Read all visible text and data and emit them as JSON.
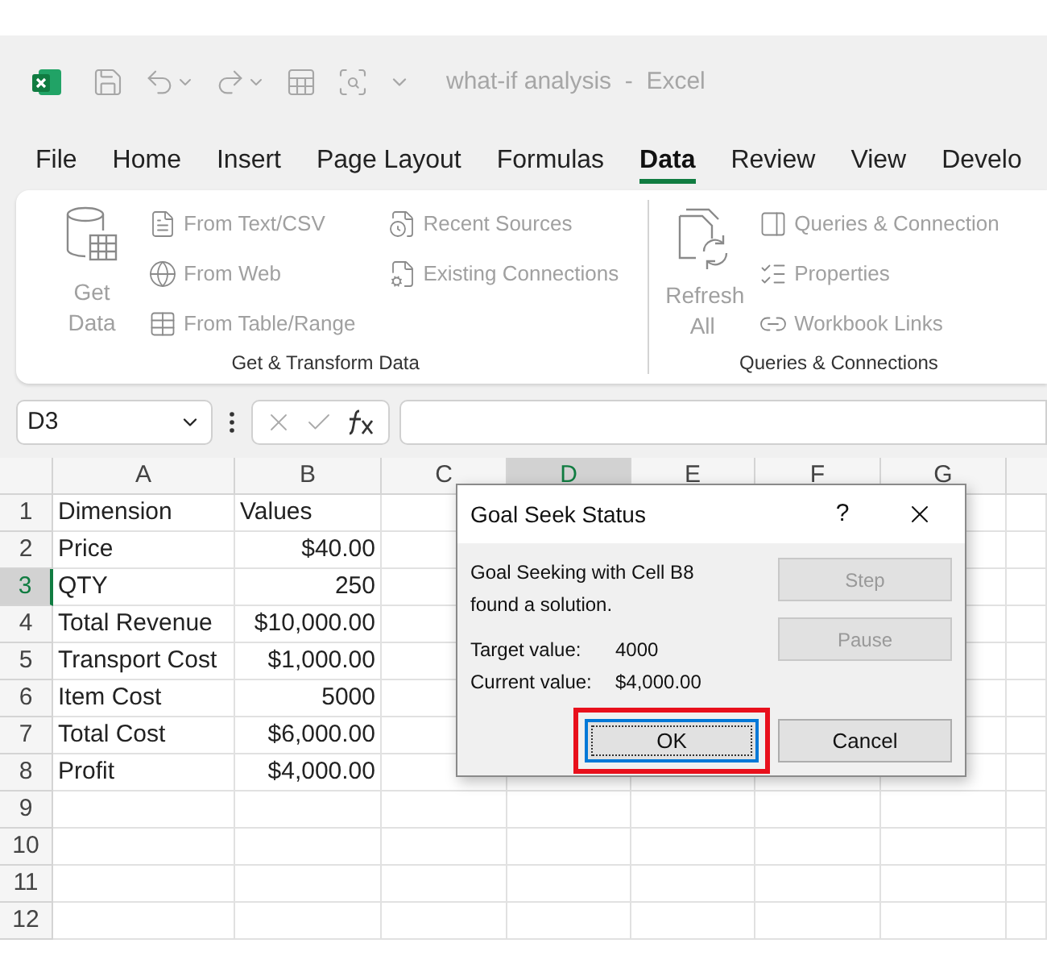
{
  "title_bar": {
    "title": "what-if analysis  -  Excel"
  },
  "tabs": [
    {
      "label": "File",
      "selected": false
    },
    {
      "label": "Home",
      "selected": false
    },
    {
      "label": "Insert",
      "selected": false
    },
    {
      "label": "Page Layout",
      "selected": false
    },
    {
      "label": "Formulas",
      "selected": false
    },
    {
      "label": "Data",
      "selected": true
    },
    {
      "label": "Review",
      "selected": false
    },
    {
      "label": "View",
      "selected": false
    },
    {
      "label": "Develo",
      "selected": false
    }
  ],
  "ribbon": {
    "groups": [
      {
        "label": "Get & Transform Data",
        "large": {
          "label": "Get Data",
          "kind": "get",
          "disabled": true
        },
        "columns": [
          [
            {
              "label": "From Text/CSV",
              "kind": "text",
              "disabled": true
            },
            {
              "label": "From Web",
              "kind": "web",
              "disabled": true
            },
            {
              "label": "From Table/Range",
              "kind": "table",
              "disabled": true
            }
          ],
          [
            {
              "label": "Recent Sources",
              "kind": "recent",
              "disabled": true
            },
            {
              "label": "Existing Connections",
              "kind": "existing",
              "disabled": true
            }
          ]
        ]
      },
      {
        "label": "Queries & Connections",
        "large": {
          "label": "Refresh All",
          "kind": "refresh",
          "disabled": true
        },
        "columns": [
          [
            {
              "label": "Queries & Connection",
              "kind": "queries",
              "disabled": true
            },
            {
              "label": "Properties",
              "kind": "properties",
              "disabled": true
            },
            {
              "label": "Workbook Links",
              "kind": "links",
              "disabled": true
            }
          ]
        ]
      }
    ]
  },
  "formula_bar": {
    "name_box": "D3"
  },
  "sheet": {
    "columns": [
      {
        "label": "A",
        "selected": false
      },
      {
        "label": "B",
        "selected": false
      },
      {
        "label": "C",
        "selected": false
      },
      {
        "label": "D",
        "selected": true
      },
      {
        "label": "E",
        "selected": false
      },
      {
        "label": "F",
        "selected": false
      },
      {
        "label": "G",
        "selected": false
      }
    ],
    "rows": [
      {
        "header": "1",
        "selected": false,
        "cells": [
          {
            "text": "Dimension",
            "kind": "text"
          },
          {
            "text": "Values",
            "kind": "text"
          }
        ]
      },
      {
        "header": "2",
        "selected": false,
        "cells": [
          {
            "text": "Price",
            "kind": "text"
          },
          {
            "text": "$40.00",
            "kind": "number"
          }
        ]
      },
      {
        "header": "3",
        "selected": true,
        "cells": [
          {
            "text": "QTY",
            "kind": "text"
          },
          {
            "text": "250",
            "kind": "number"
          }
        ]
      },
      {
        "header": "4",
        "selected": false,
        "cells": [
          {
            "text": "Total Revenue",
            "kind": "text"
          },
          {
            "text": "$10,000.00",
            "kind": "number"
          }
        ]
      },
      {
        "header": "5",
        "selected": false,
        "cells": [
          {
            "text": "Transport Cost",
            "kind": "text"
          },
          {
            "text": "$1,000.00",
            "kind": "number"
          }
        ]
      },
      {
        "header": "6",
        "selected": false,
        "cells": [
          {
            "text": "Item Cost",
            "kind": "text"
          },
          {
            "text": "5000",
            "kind": "number"
          }
        ]
      },
      {
        "header": "7",
        "selected": false,
        "cells": [
          {
            "text": "Total Cost",
            "kind": "text"
          },
          {
            "text": "$6,000.00",
            "kind": "number"
          }
        ]
      },
      {
        "header": "8",
        "selected": false,
        "cells": [
          {
            "text": "Profit",
            "kind": "text"
          },
          {
            "text": "$4,000.00",
            "kind": "number"
          }
        ]
      },
      {
        "header": "9",
        "selected": false,
        "cells": []
      },
      {
        "header": "10",
        "selected": false,
        "cells": []
      },
      {
        "header": "11",
        "selected": false,
        "cells": []
      },
      {
        "header": "12",
        "selected": false,
        "cells": []
      }
    ]
  },
  "dialog": {
    "title": "Goal Seek Status",
    "help": "?",
    "message": "Goal Seeking with Cell B8 found a solution.",
    "fields": [
      {
        "label": "Target value:",
        "value": "4000"
      },
      {
        "label": "Current value:",
        "value": "$4,000.00"
      }
    ],
    "side_buttons": [
      {
        "label": "Step",
        "disabled": true
      },
      {
        "label": "Pause",
        "disabled": true
      }
    ],
    "bottom_buttons": [
      {
        "label": "OK",
        "focused": true,
        "highlighted": true
      },
      {
        "label": "Cancel",
        "focused": false,
        "highlighted": false
      }
    ]
  }
}
